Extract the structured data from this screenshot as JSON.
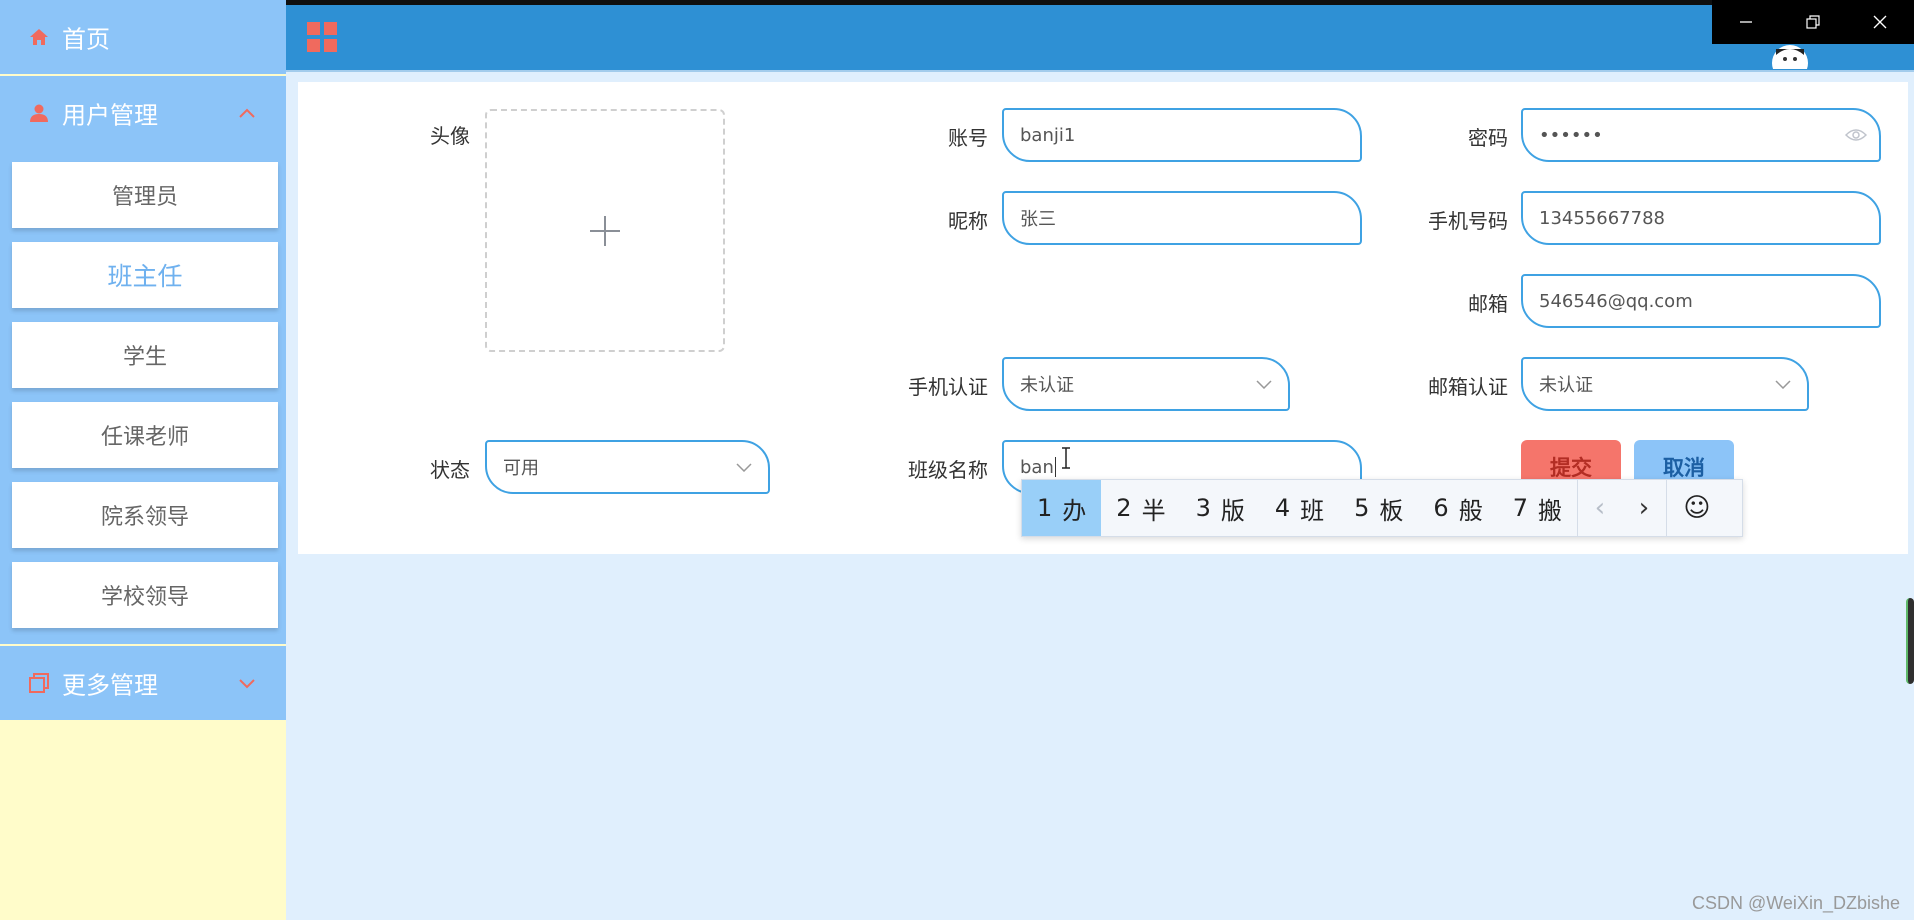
{
  "sidebar": {
    "home_label": "首页",
    "user_mgmt_label": "用户管理",
    "more_mgmt_label": "更多管理",
    "items": [
      {
        "label": "管理员"
      },
      {
        "label": "班主任"
      },
      {
        "label": "学生"
      },
      {
        "label": "任课老师"
      },
      {
        "label": "院系领导"
      },
      {
        "label": "学校领导"
      }
    ],
    "active_index": 1
  },
  "form": {
    "avatar_label": "头像",
    "account_label": "账号",
    "account_value": "banji1",
    "password_label": "密码",
    "password_value": "••••••",
    "nickname_label": "昵称",
    "nickname_value": "张三",
    "phone_label": "手机号码",
    "phone_value": "13455667788",
    "email_label": "邮箱",
    "email_value": "546546@qq.com",
    "phone_verify_label": "手机认证",
    "phone_verify_value": "未认证",
    "email_verify_label": "邮箱认证",
    "email_verify_value": "未认证",
    "status_label": "状态",
    "status_value": "可用",
    "class_label": "班级名称",
    "class_value": "ban",
    "submit_label": "提交",
    "cancel_label": "取消"
  },
  "ime": {
    "candidates": [
      {
        "num": "1",
        "char": "办"
      },
      {
        "num": "2",
        "char": "半"
      },
      {
        "num": "3",
        "char": "版"
      },
      {
        "num": "4",
        "char": "班"
      },
      {
        "num": "5",
        "char": "板"
      },
      {
        "num": "6",
        "char": "般"
      },
      {
        "num": "7",
        "char": "搬"
      }
    ],
    "prev_glyph": "‹",
    "next_glyph": "›",
    "emoji_glyph": "☺"
  },
  "watermark": "CSDN @WeiXin_DZbishe",
  "colors": {
    "sidebar_blue": "#8cc4f8",
    "sidebar_bg": "#fffcca",
    "topbar": "#2e90d4",
    "field_border": "#3fa2e3",
    "submit": "#f5756b",
    "cancel": "#8cc4f8",
    "accent_red": "#f06a5e",
    "page_bg": "#e0effd"
  },
  "icons": {
    "home": "home-icon",
    "user": "user-icon",
    "more": "layers-icon",
    "grid": "grid-icon",
    "eye": "eye-icon",
    "plus": "plus-icon"
  }
}
